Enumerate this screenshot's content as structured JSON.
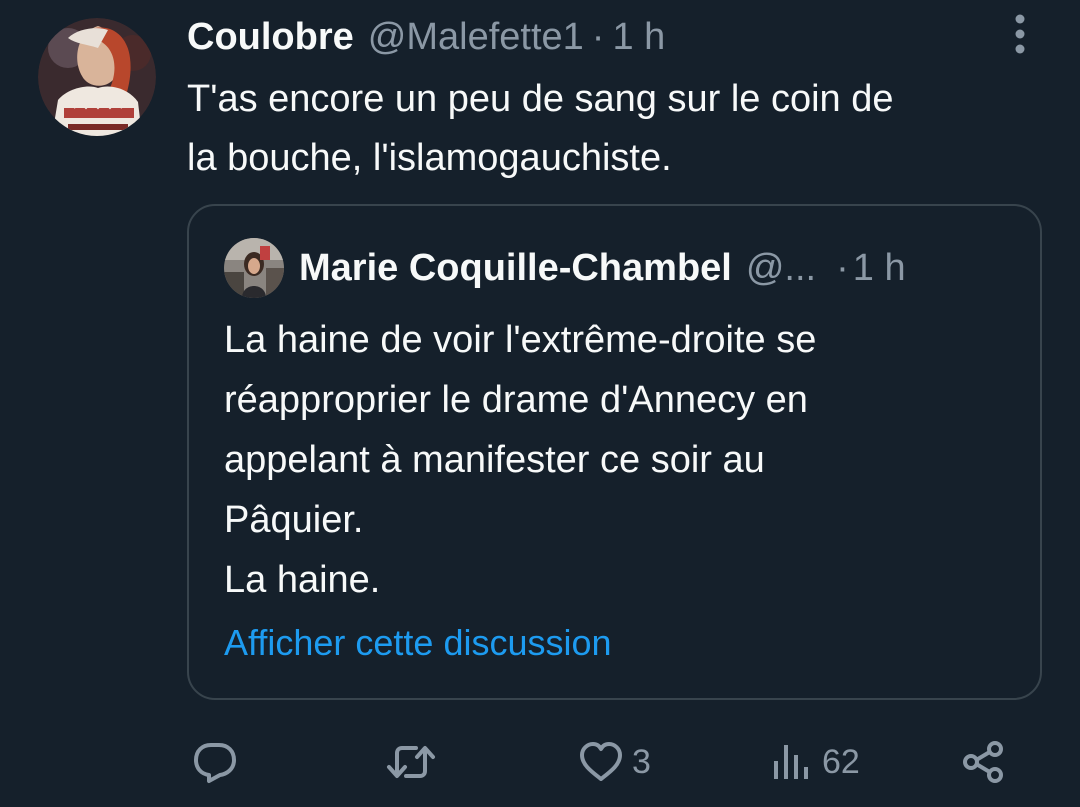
{
  "tweet": {
    "display_name": "Coulobre",
    "handle": "@Malefette1",
    "separator": "·",
    "time": "1 h",
    "text_lines": [
      "T'as encore un peu de sang sur le coin de",
      "la bouche, l'islamogauchiste."
    ],
    "avatar_icon": "avatar-illustration",
    "more_icon": "more-vertical-icon"
  },
  "quote": {
    "display_name": "Marie Coquille-Chambel",
    "handle": "@...",
    "separator": "·",
    "time": "1 h",
    "text_lines": [
      "La haine de voir l'extrême-droite se",
      "réapproprier le drame d'Annecy en",
      "appelant à manifester ce soir au",
      "Pâquier.",
      "La haine."
    ],
    "show_thread_label": "Afficher cette discussion",
    "avatar_icon": "avatar-photo"
  },
  "actions": {
    "reply": {
      "icon": "reply-icon",
      "count": ""
    },
    "retweet": {
      "icon": "retweet-icon",
      "count": ""
    },
    "like": {
      "icon": "heart-icon",
      "count": "3"
    },
    "views": {
      "icon": "views-icon",
      "count": "62"
    },
    "share": {
      "icon": "share-icon"
    }
  },
  "colors": {
    "background": "#15202b",
    "primary_text": "#f7f9f9",
    "secondary_text": "#8b98a5",
    "link": "#1d9bf0",
    "border": "#38444d"
  }
}
